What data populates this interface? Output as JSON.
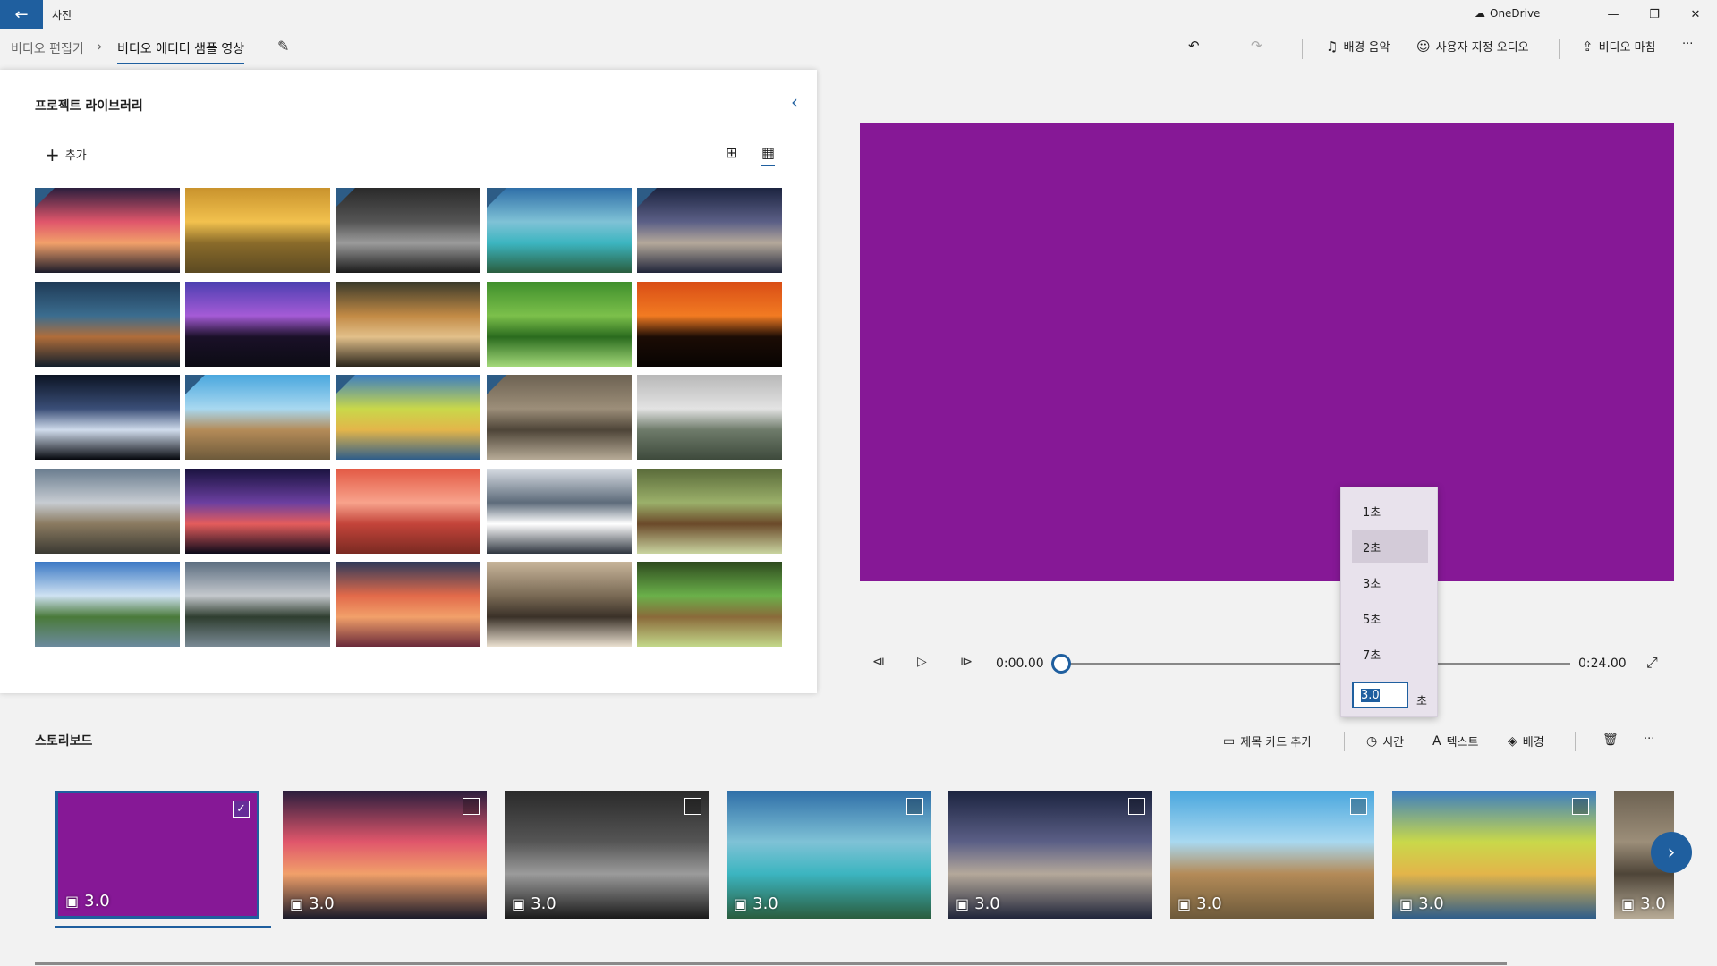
{
  "window": {
    "app_title": "사진",
    "onedrive": "OneDrive",
    "back_icon": "back-arrow-icon",
    "minimize_glyph": "—",
    "restore_glyph": "❐",
    "close_glyph": "✕"
  },
  "breadcrumb": {
    "root": "비디오 편집기",
    "separator": "›",
    "current": "비디오 에디터 샘플 영상"
  },
  "toolbar": {
    "undo_glyph": "↶",
    "redo_glyph": "↷",
    "background_music": "배경 음악",
    "custom_audio": "사용자 지정 오디오",
    "finish_video": "비디오 마침",
    "more_glyph": "···"
  },
  "library": {
    "title": "프로젝트 라이브러리",
    "add_label": "추가",
    "collapse_glyph": "‹",
    "view_large_glyph": "⊞",
    "view_small_glyph": "▦",
    "thumbs": [
      {
        "colors": [
          "#2b1e3d",
          "#e0566b",
          "#f1a06a",
          "#1b1b2a"
        ],
        "used": true
      },
      {
        "colors": [
          "#c9932d",
          "#f2c14e",
          "#8a6b2a",
          "#5b4a22"
        ],
        "used": false
      },
      {
        "colors": [
          "#2a2a2a",
          "#555555",
          "#9b9b9b",
          "#1a1a1a"
        ],
        "used": true
      },
      {
        "colors": [
          "#2f6fa8",
          "#7fc2d6",
          "#3cb5c0",
          "#2a5d3e"
        ],
        "used": true
      },
      {
        "colors": [
          "#1c2440",
          "#5b5f86",
          "#b4a89a",
          "#20253a"
        ],
        "used": true
      },
      {
        "colors": [
          "#1f3a56",
          "#3b6d8f",
          "#b06d3a",
          "#131f2c"
        ],
        "used": false
      },
      {
        "colors": [
          "#4c3fb0",
          "#a55bd6",
          "#1a1028",
          "#0c0c14"
        ],
        "used": false
      },
      {
        "colors": [
          "#3a3a2a",
          "#c28a45",
          "#e2c08a",
          "#2a251b"
        ],
        "used": false
      },
      {
        "colors": [
          "#3f8f2c",
          "#7cc04b",
          "#2a6b1e",
          "#a4d97a"
        ],
        "used": false
      },
      {
        "colors": [
          "#d94d16",
          "#f27b22",
          "#1b0c05",
          "#080402"
        ],
        "used": false
      },
      {
        "colors": [
          "#0c1424",
          "#3a4e77",
          "#d0dcec",
          "#05070d"
        ],
        "used": false
      },
      {
        "colors": [
          "#4aa7de",
          "#a8d8f0",
          "#b48b58",
          "#6d5a3b"
        ],
        "used": true
      },
      {
        "colors": [
          "#3c7ec1",
          "#c9d84a",
          "#e3b54a",
          "#2e5d8a"
        ],
        "used": true
      },
      {
        "colors": [
          "#6d6252",
          "#9c8e79",
          "#4e4538",
          "#b7ab97"
        ],
        "used": true
      },
      {
        "colors": [
          "#b8b8b8",
          "#e3e3e3",
          "#6e7b6a",
          "#3e4a3c"
        ],
        "used": false
      },
      {
        "colors": [
          "#6a7d8f",
          "#c7ccd2",
          "#8a7a60",
          "#3b3a33"
        ],
        "used": false
      },
      {
        "colors": [
          "#1a1340",
          "#6b3fa0",
          "#e35c5c",
          "#0c0a1a"
        ],
        "used": false
      },
      {
        "colors": [
          "#e35a45",
          "#f8a38c",
          "#c3443a",
          "#7a2a22"
        ],
        "used": false
      },
      {
        "colors": [
          "#d6dbe2",
          "#5d6b7a",
          "#ffffff",
          "#2f3640"
        ],
        "used": false
      },
      {
        "colors": [
          "#5a6b3a",
          "#9bb06a",
          "#6b4a2a",
          "#c9d4a0"
        ],
        "used": false
      },
      {
        "colors": [
          "#3a78c4",
          "#cfe2f2",
          "#4a7a3a",
          "#6b8a9e"
        ],
        "used": false
      },
      {
        "colors": [
          "#5b6d80",
          "#c5c9cd",
          "#2f3e30",
          "#7a8a95"
        ],
        "used": false
      },
      {
        "colors": [
          "#2e3a5a",
          "#e26a4a",
          "#f2a06a",
          "#6a2a3a"
        ],
        "used": false
      },
      {
        "colors": [
          "#c7b59a",
          "#7a6a55",
          "#3a3128",
          "#eae0d0"
        ],
        "used": false
      },
      {
        "colors": [
          "#2e4a1e",
          "#6ab04a",
          "#8a6a3a",
          "#c3d88a"
        ],
        "used": false
      }
    ]
  },
  "preview": {
    "color": "#861896",
    "current_time": "0:00.00",
    "total_time": "0:24.00",
    "skip_back_glyph": "⧏",
    "play_glyph": "▷",
    "skip_forward_glyph": "⧐",
    "fullscreen_glyph": "⤢",
    "progress": 0.0
  },
  "duration_flyout": {
    "options": [
      "1초",
      "2초",
      "3초",
      "5초",
      "7초"
    ],
    "selected_index": 1,
    "input_value": "3.0",
    "unit": "초"
  },
  "storyboard": {
    "title": "스토리보드",
    "add_title_card": "제목 카드 추가",
    "duration": "시간",
    "text": "텍스트",
    "background": "배경",
    "delete_glyph": "🗑",
    "more_glyph": "···",
    "next_glyph": "›",
    "clips": [
      {
        "duration": "3.0",
        "colors": [
          "#861896",
          "#861896",
          "#861896",
          "#861896"
        ],
        "selected": true
      },
      {
        "duration": "3.0",
        "colors": [
          "#2b1e3d",
          "#e0566b",
          "#f1a06a",
          "#1b1b2a"
        ],
        "selected": false
      },
      {
        "duration": "3.0",
        "colors": [
          "#2a2a2a",
          "#555555",
          "#9b9b9b",
          "#1a1a1a"
        ],
        "selected": false
      },
      {
        "duration": "3.0",
        "colors": [
          "#2f6fa8",
          "#7fc2d6",
          "#3cb5c0",
          "#2a5d3e"
        ],
        "selected": false
      },
      {
        "duration": "3.0",
        "colors": [
          "#1c2440",
          "#5b5f86",
          "#b4a89a",
          "#20253a"
        ],
        "selected": false
      },
      {
        "duration": "3.0",
        "colors": [
          "#4aa7de",
          "#a8d8f0",
          "#b48b58",
          "#6d5a3b"
        ],
        "selected": false
      },
      {
        "duration": "3.0",
        "colors": [
          "#3c7ec1",
          "#c9d84a",
          "#e3b54a",
          "#2e5d8a"
        ],
        "selected": false
      },
      {
        "duration": "3.0",
        "colors": [
          "#6d6252",
          "#9c8e79",
          "#4e4538",
          "#b7ab97"
        ],
        "selected": false
      }
    ]
  }
}
